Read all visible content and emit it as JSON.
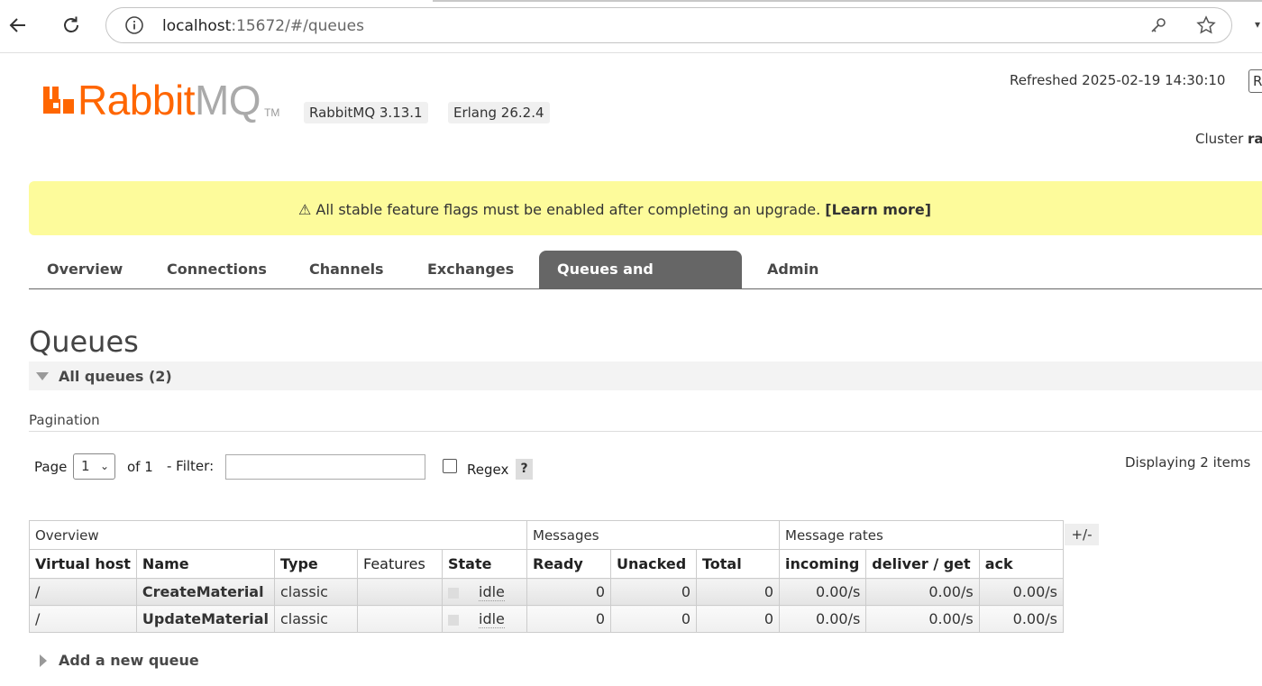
{
  "browser": {
    "url_host": "localhost",
    "url_rest": ":15672/#/queues"
  },
  "header": {
    "logo_rabbit": "Rabbit",
    "logo_mq": "MQ",
    "logo_tm": "TM",
    "rabbitmq_version": "RabbitMQ 3.13.1",
    "erlang_version": "Erlang 26.2.4",
    "refreshed": "Refreshed 2025-02-19 14:30:10",
    "refresh_box": "R",
    "cluster_label": "Cluster",
    "cluster_name": "ra"
  },
  "banner": {
    "text": "⚠ All stable feature flags must be enabled after completing an upgrade.",
    "link": "[Learn more]"
  },
  "tabs": [
    "Overview",
    "Connections",
    "Channels",
    "Exchanges",
    "Queues and Streams",
    "Admin"
  ],
  "active_tab": "Queues and Streams",
  "page": {
    "title": "Queues",
    "section": "All queues (2)",
    "pagination_label": "Pagination",
    "page_label": "Page",
    "page_value": "1",
    "of_label": "of 1",
    "filter_label": "- Filter:",
    "filter_value": "",
    "regex_label": "Regex",
    "regex_checked": false,
    "help": "?",
    "displaying": "Displaying 2 items",
    "plus_minus": "+/-",
    "add_queue": "Add a new queue"
  },
  "table": {
    "groups": [
      "Overview",
      "Messages",
      "Message rates"
    ],
    "columns": [
      "Virtual host",
      "Name",
      "Type",
      "Features",
      "State",
      "Ready",
      "Unacked",
      "Total",
      "incoming",
      "deliver / get",
      "ack"
    ],
    "rows": [
      {
        "vhost": "/",
        "name": "CreateMaterial",
        "type": "classic",
        "features": "",
        "state": "idle",
        "ready": "0",
        "unacked": "0",
        "total": "0",
        "incoming": "0.00/s",
        "deliver_get": "0.00/s",
        "ack": "0.00/s"
      },
      {
        "vhost": "/",
        "name": "UpdateMaterial",
        "type": "classic",
        "features": "",
        "state": "idle",
        "ready": "0",
        "unacked": "0",
        "total": "0",
        "incoming": "0.00/s",
        "deliver_get": "0.00/s",
        "ack": "0.00/s"
      }
    ]
  },
  "colors": {
    "brand_orange": "#ff6600",
    "banner_yellow": "#fdfb9b",
    "active_tab": "#666666"
  }
}
